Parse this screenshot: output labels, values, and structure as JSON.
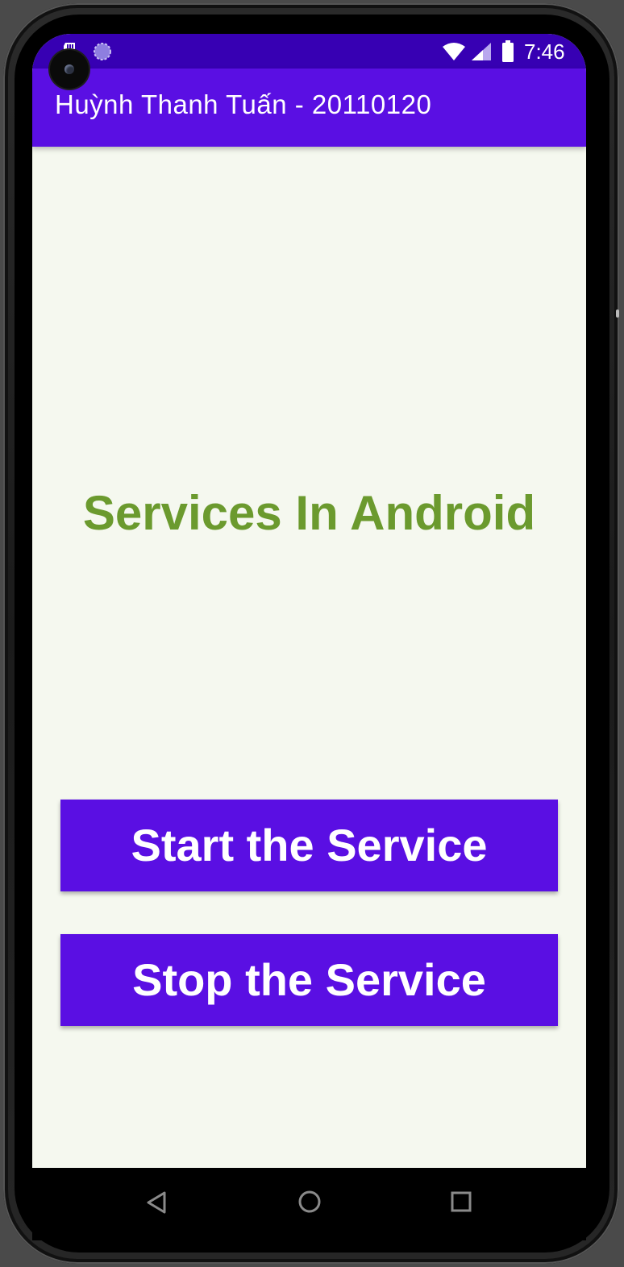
{
  "status_bar": {
    "time": "7:46",
    "left_icons": [
      "sd-card-icon",
      "loading-icon"
    ],
    "right_icons": [
      "wifi-icon",
      "signal-icon",
      "battery-icon"
    ]
  },
  "app_bar": {
    "title": "Huỳnh Thanh Tuấn - 20110120"
  },
  "main": {
    "heading": "Services In Android",
    "buttons": {
      "start": "Start the Service",
      "stop": "Stop the Service"
    }
  },
  "nav_bar": {
    "icons": [
      "back-icon",
      "home-icon",
      "recent-apps-icon"
    ]
  },
  "colors": {
    "status_bar": "#3700b3",
    "app_bar": "#5a0fe3",
    "button": "#5a0fe3",
    "heading": "#6b9a2e",
    "background": "#f5f8ef"
  }
}
